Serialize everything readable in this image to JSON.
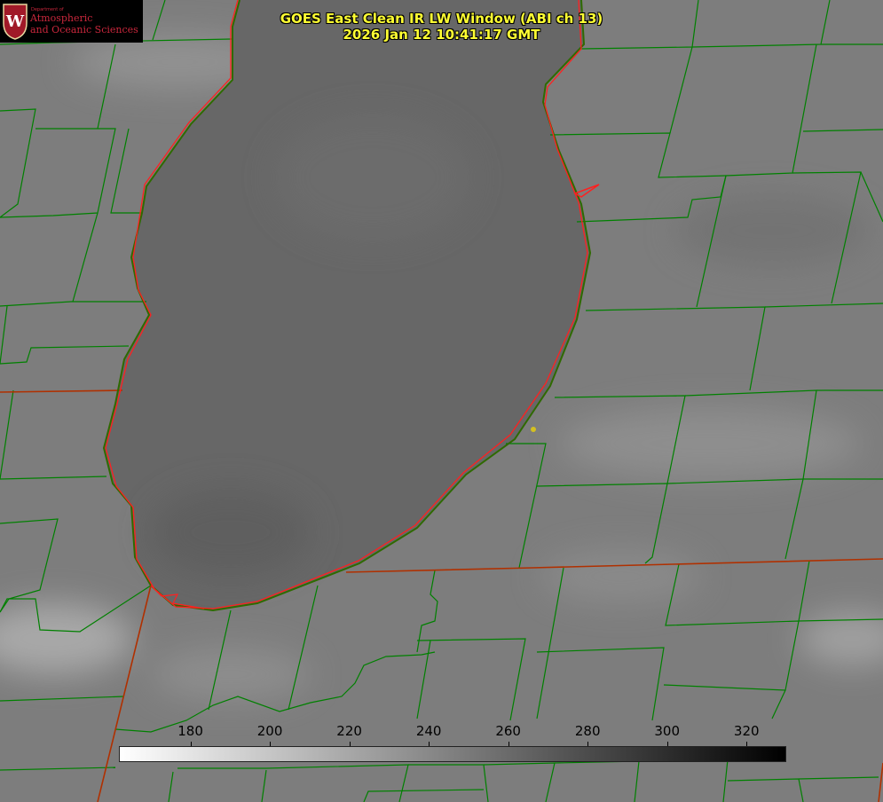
{
  "logo": {
    "department_label": "Department of",
    "line1": "Atmospheric",
    "line2": "and Oceanic Sciences",
    "emblem_letter": "W"
  },
  "title": {
    "line1": "GOES East Clean IR LW Window (ABI ch 13)",
    "line2": "2026 Jan 12 10:41:17 GMT"
  },
  "colorbar": {
    "min": 162,
    "max": 330,
    "ticks": [
      "180",
      "200",
      "220",
      "240",
      "260",
      "280",
      "300",
      "320"
    ],
    "gradient_start": "#ffffff",
    "gradient_end": "#000000"
  },
  "colors": {
    "title_text": "#ffff33",
    "county_lines": "#008000",
    "state_lines": "#b03000",
    "lake_outline": "#ff2020",
    "marker": "#d4c020"
  }
}
